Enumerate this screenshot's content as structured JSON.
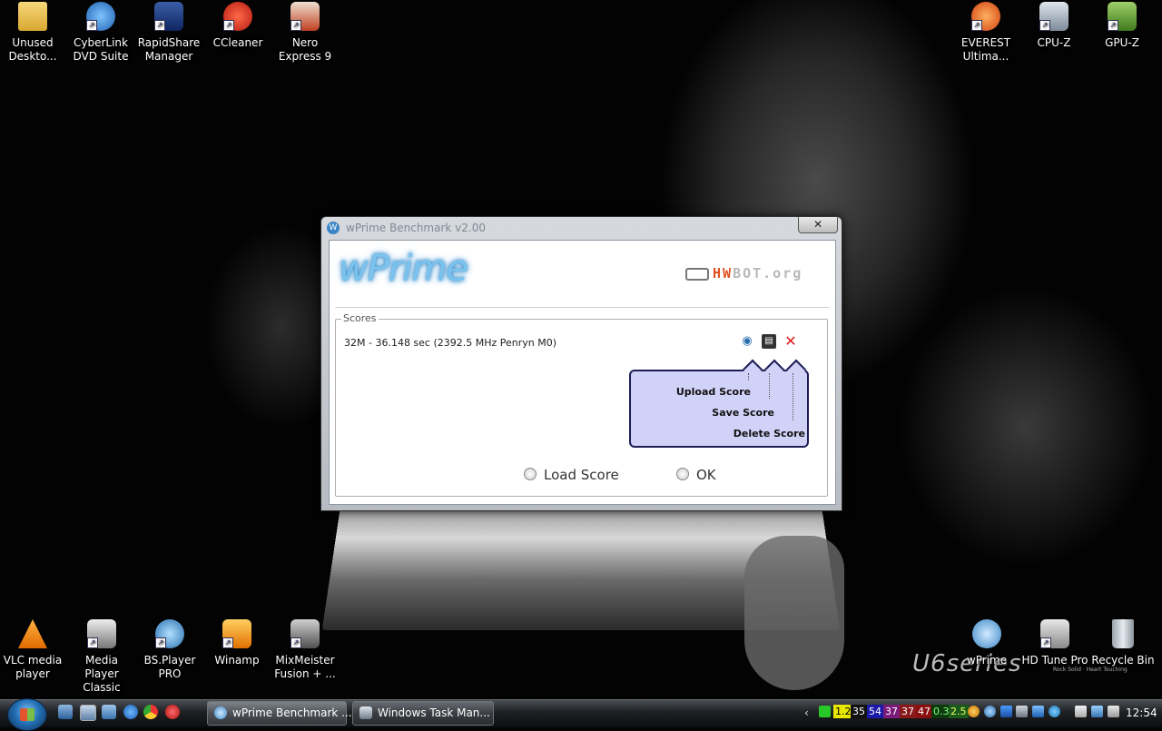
{
  "desktop_icons_top_left": [
    {
      "label": "Unused Deskto...",
      "icon": "folder-icon"
    },
    {
      "label": "CyberLink DVD Suite",
      "icon": "cyberlink-icon"
    },
    {
      "label": "RapidShare Manager",
      "icon": "rapidshare-icon"
    },
    {
      "label": "CCleaner",
      "icon": "ccleaner-icon"
    },
    {
      "label": "Nero Express 9",
      "icon": "nero-icon"
    }
  ],
  "desktop_icons_top_right": [
    {
      "label": "EVEREST Ultima...",
      "icon": "everest-icon"
    },
    {
      "label": "CPU-Z",
      "icon": "cpuz-icon"
    },
    {
      "label": "GPU-Z",
      "icon": "gpuz-icon"
    }
  ],
  "desktop_icons_bottom_left": [
    {
      "label": "VLC media player",
      "icon": "vlc-icon"
    },
    {
      "label": "Media Player Classic",
      "icon": "mpc-icon"
    },
    {
      "label": "BS.Player PRO",
      "icon": "bsplayer-icon"
    },
    {
      "label": "Winamp",
      "icon": "winamp-icon"
    },
    {
      "label": "MixMeister Fusion + ...",
      "icon": "mixmeister-icon"
    }
  ],
  "desktop_icons_bottom_right": [
    {
      "label": "wPrime",
      "icon": "wprime-icon"
    },
    {
      "label": "HD Tune Pro",
      "icon": "hdtune-icon"
    },
    {
      "label": "Recycle Bin",
      "icon": "recycle-bin-icon"
    }
  ],
  "wallpaper": {
    "brand": "U6series",
    "tagline": "Rock Solid · Heart Touching"
  },
  "window": {
    "title": "wPrime Benchmark v2.00",
    "close_label": "✕",
    "logo_text": "wPrime",
    "partner_logo": {
      "prefix": "HW",
      "suffix": "BOT.org"
    },
    "scores_legend": "Scores",
    "score_entry": "32M - 36.148 sec (2392.5 MHz Penryn M0)",
    "tooltip_items": [
      "Upload Score",
      "Save Score",
      "Delete Score"
    ],
    "radio_load_label": "Load Score",
    "radio_ok_label": "OK"
  },
  "taskbar": {
    "buttons": [
      {
        "label": "wPrime Benchmark ...",
        "active": true
      },
      {
        "label": "Windows Task Man...",
        "active": false
      }
    ],
    "tray_numbers": [
      {
        "text": "1.2",
        "bg": "#e8e800",
        "fg": "#000"
      },
      {
        "text": "35",
        "bg": "#111111",
        "fg": "#fff"
      },
      {
        "text": "54",
        "bg": "#1a1aa8",
        "fg": "#fff"
      },
      {
        "text": "37",
        "bg": "#7a1a7a",
        "fg": "#fff"
      },
      {
        "text": "37",
        "bg": "#8a1a1a",
        "fg": "#fff"
      },
      {
        "text": "47",
        "bg": "#8a1010",
        "fg": "#fff"
      },
      {
        "text": "0.3",
        "bg": "#0c3a0c",
        "fg": "#7fff7f"
      },
      {
        "text": "2.5",
        "bg": "#1a5a1a",
        "fg": "#eaff6a"
      }
    ],
    "clock": "12:54"
  },
  "colors": {
    "accent": "#3d86c6",
    "tooltip_bg": "#d1d2f7",
    "tooltip_border": "#1d1d55",
    "delete_red": "#e01b1b"
  }
}
